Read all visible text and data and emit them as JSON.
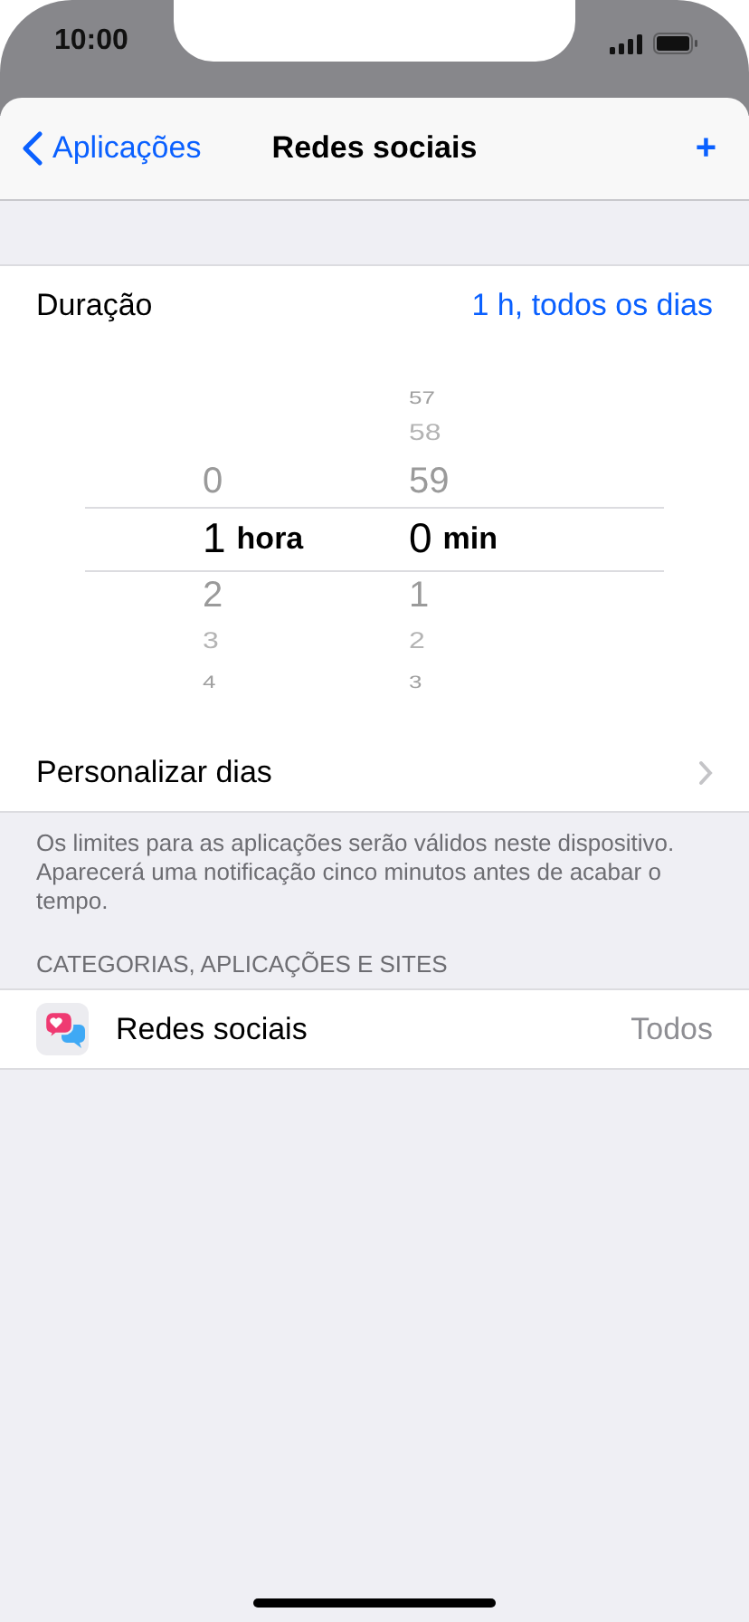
{
  "status_bar": {
    "time": "10:00"
  },
  "nav": {
    "back": "Aplicações",
    "title": "Redes sociais",
    "action": "+"
  },
  "duration": {
    "label": "Duração",
    "value": "1 h, todos os dias"
  },
  "picker": {
    "columns": [
      {
        "above": [
          "0"
        ],
        "selected": "1",
        "unit": "hora",
        "below": [
          "2",
          "3",
          "4"
        ]
      },
      {
        "above": [
          "57",
          "58",
          "59"
        ],
        "selected": "0",
        "unit": "min",
        "below": [
          "1",
          "2",
          "3"
        ]
      }
    ]
  },
  "custom_days": {
    "label": "Personalizar dias"
  },
  "footer_note": "Os limites para as aplicações serão válidos neste dispositivo. Aparecerá uma notificação cinco minutos antes de acabar o tempo.",
  "section_header": "CATEGORIAS, APLICAÇÕES E SITES",
  "items": [
    {
      "name": "Redes sociais",
      "value": "Todos"
    }
  ]
}
